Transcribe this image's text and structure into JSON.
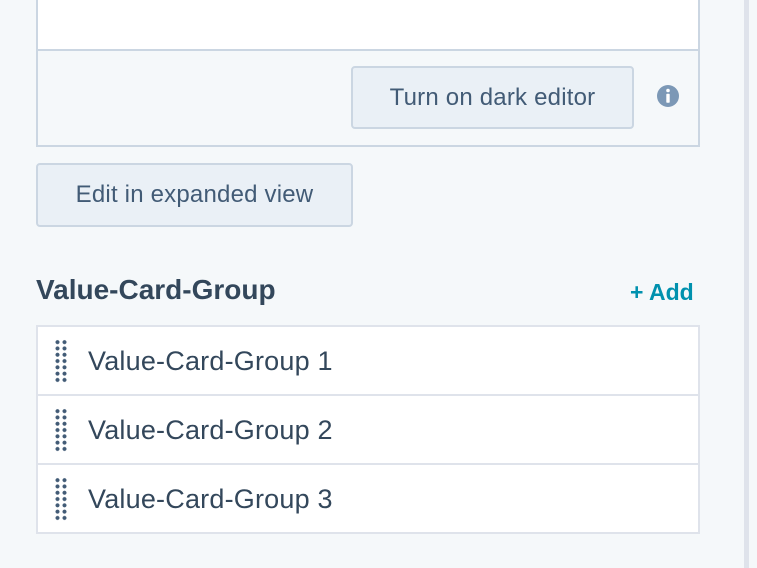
{
  "editor": {
    "dark_editor_label": "Turn on dark editor",
    "info_icon": "info-circle-icon"
  },
  "expand_button_label": "Edit in expanded view",
  "group_section": {
    "title": "Value-Card-Group",
    "add_label": "+ Add",
    "items": [
      {
        "label": "Value-Card-Group 1"
      },
      {
        "label": "Value-Card-Group 2"
      },
      {
        "label": "Value-Card-Group 3"
      }
    ]
  },
  "colors": {
    "accent_link": "#0091ae",
    "text": "#33475b",
    "button_bg": "#eaf0f6",
    "border": "#cbd6e2"
  }
}
